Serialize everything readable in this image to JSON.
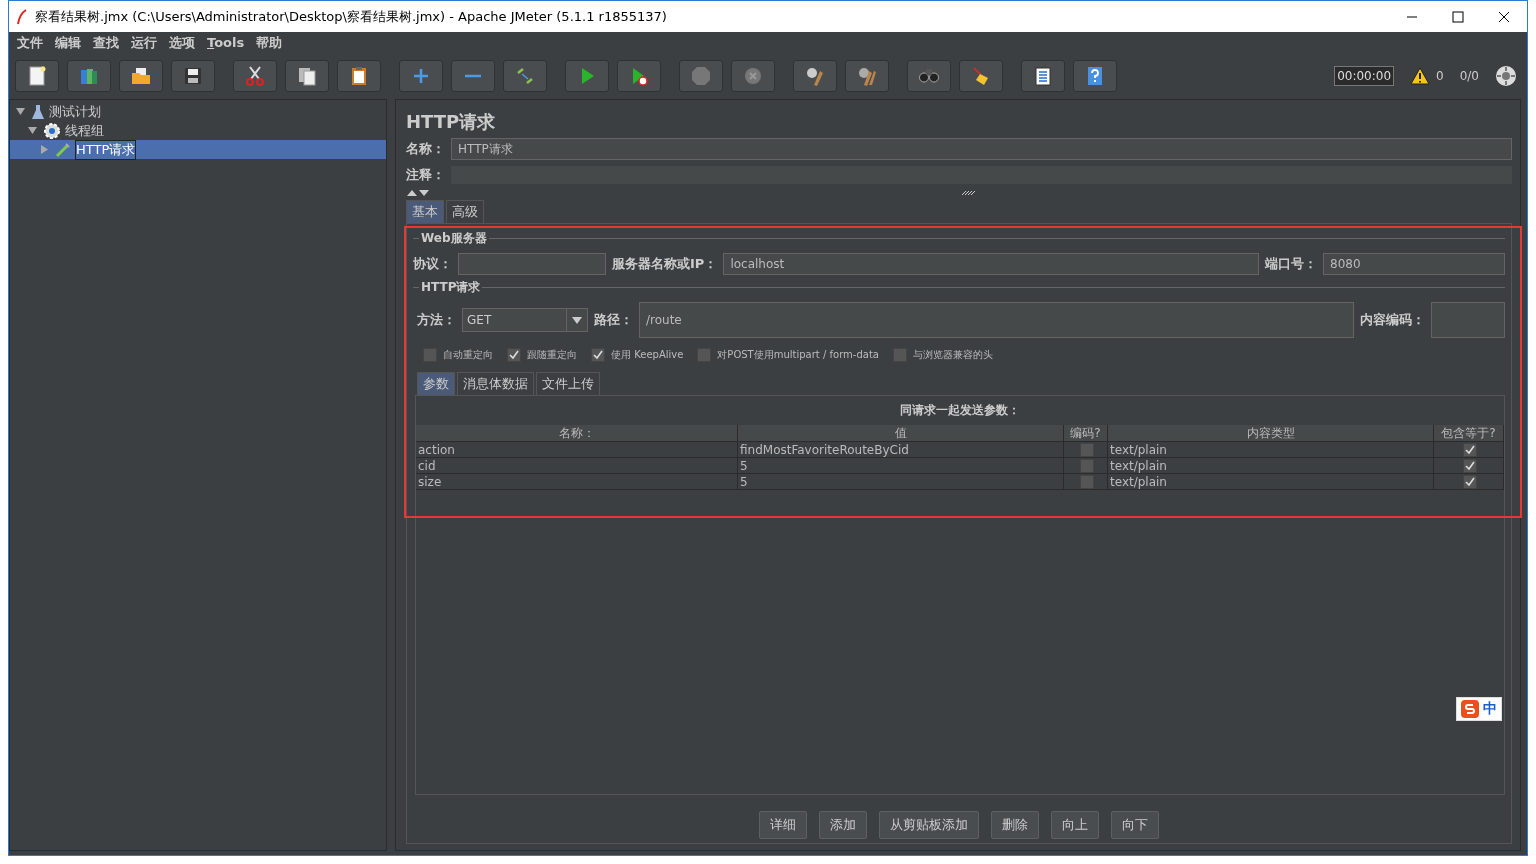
{
  "window": {
    "title": "察看结果树.jmx (C:\\Users\\Administrator\\Desktop\\察看结果树.jmx) - Apache JMeter (5.1.1 r1855137)"
  },
  "menu": [
    {
      "label": "文件",
      "mnemonic": false
    },
    {
      "label": "编辑",
      "mnemonic": false
    },
    {
      "label": "查找",
      "mnemonic": false
    },
    {
      "label": "运行",
      "mnemonic": false
    },
    {
      "label": "选项",
      "mnemonic": false
    },
    {
      "label": "Tools",
      "mnemonic": true
    },
    {
      "label": "帮助",
      "mnemonic": false
    }
  ],
  "toolbar": {
    "timer": "00:00:00",
    "warnings": "0",
    "threads": "0/0"
  },
  "tree": [
    {
      "label": "测试计划",
      "kind": "plan",
      "expanded": true,
      "selected": false,
      "children": [
        {
          "label": "线程组",
          "kind": "group",
          "expanded": true,
          "selected": false,
          "children": [
            {
              "label": "HTTP请求",
              "kind": "sampler",
              "expanded": false,
              "selected": true
            }
          ]
        }
      ]
    }
  ],
  "editor": {
    "title": "HTTP请求",
    "name_label": "名称：",
    "name_value": "HTTP请求",
    "comment_label": "注释："
  },
  "tabs": [
    {
      "label": "基本",
      "selected": true
    },
    {
      "label": "高级",
      "selected": false
    }
  ],
  "web_server": {
    "legend": "Web服务器",
    "protocol_label": "协议：",
    "server_label": "服务器名称或IP：",
    "server_value": "localhost",
    "port_label": "端口号：",
    "port_value": "8080"
  },
  "http_request": {
    "legend": "HTTP请求",
    "method_label": "方法：",
    "method_value": "GET",
    "path_label": "路径：",
    "path_value": "/route",
    "encoding_label": "内容编码：",
    "options": [
      {
        "label": "自动重定向",
        "checked": false
      },
      {
        "label": "跟随重定向",
        "checked": true
      },
      {
        "label": "使用 KeepAlive",
        "checked": true
      },
      {
        "label": "对POST使用multipart / form-data",
        "checked": false
      },
      {
        "label": "与浏览器兼容的头",
        "checked": false
      }
    ]
  },
  "sub_tabs": [
    {
      "label": "参数",
      "selected": true
    },
    {
      "label": "消息体数据",
      "selected": false
    },
    {
      "label": "文件上传",
      "selected": false
    }
  ],
  "params": {
    "caption": "同请求一起发送参数：",
    "columns": [
      "名称：",
      "值",
      "编码?",
      "内容类型",
      "包含等于?"
    ],
    "rows": [
      {
        "name": "action",
        "value": "findMostFavoriteRouteByCid",
        "encode": false,
        "content_type": "text/plain",
        "include_equals": true
      },
      {
        "name": "cid",
        "value": "5",
        "encode": false,
        "content_type": "text/plain",
        "include_equals": true
      },
      {
        "name": "size",
        "value": "5",
        "encode": false,
        "content_type": "text/plain",
        "include_equals": true
      }
    ]
  },
  "buttons": [
    "详细",
    "添加",
    "从剪贴板添加",
    "删除",
    "向上",
    "向下"
  ],
  "ime": {
    "label": "中"
  }
}
